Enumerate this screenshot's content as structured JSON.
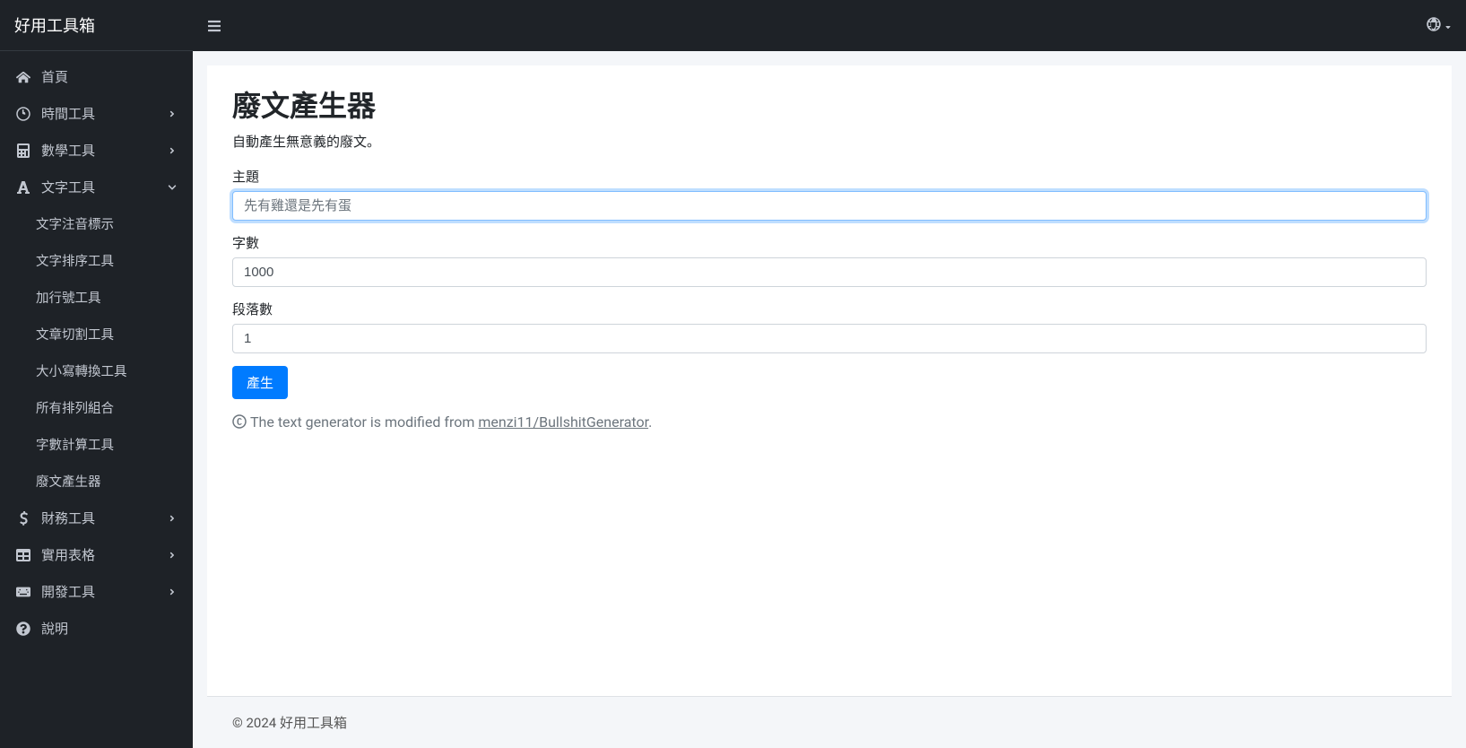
{
  "brand": "好用工具箱",
  "sidebar": {
    "home": "首頁",
    "time": "時間工具",
    "math": "數學工具",
    "text": "文字工具",
    "text_sub": [
      "文字注音標示",
      "文字排序工具",
      "加行號工具",
      "文章切割工具",
      "大小寫轉換工具",
      "所有排列組合",
      "字數計算工具",
      "廢文產生器"
    ],
    "finance": "財務工具",
    "tables": "實用表格",
    "dev": "開發工具",
    "help": "說明"
  },
  "page": {
    "title": "廢文產生器",
    "desc": "自動產生無意義的廢文。",
    "label_topic": "主題",
    "placeholder_topic": "先有雞還是先有蛋",
    "value_topic": "",
    "label_words": "字數",
    "value_words": "1000",
    "label_paragraphs": "段落數",
    "value_paragraphs": "1",
    "button_generate": "產生",
    "credit_prefix": "The text generator is modified from ",
    "credit_link": "menzi11/BullshitGenerator",
    "credit_suffix": "."
  },
  "footer": "© 2024 好用工具箱"
}
